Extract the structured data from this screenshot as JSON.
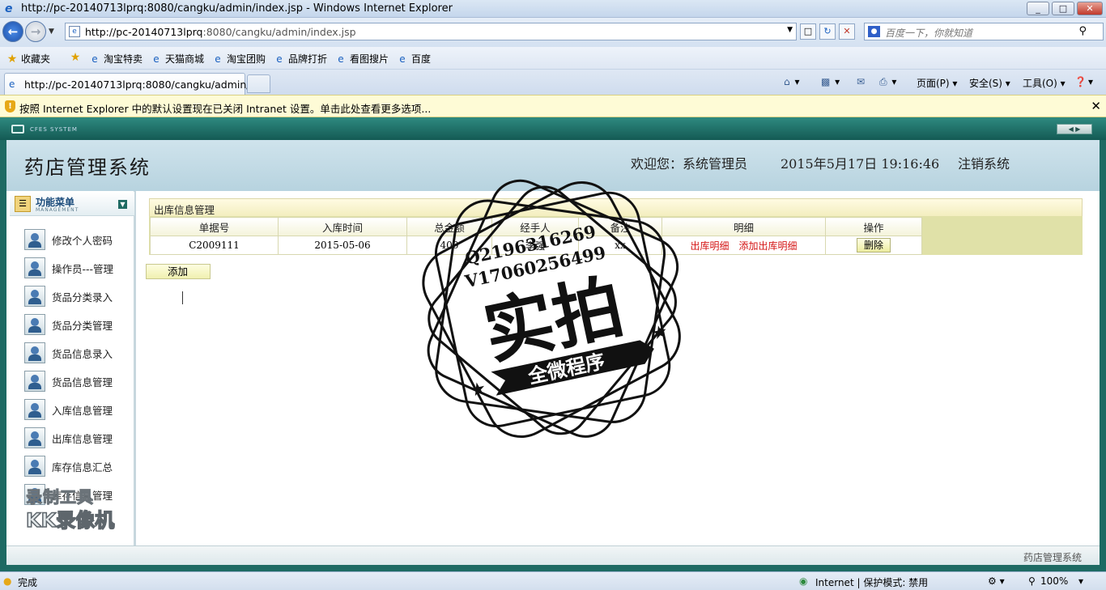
{
  "window": {
    "title": "http://pc-20140713lprq:8080/cangku/admin/index.jsp - Windows Internet Explorer",
    "controls": [
      "_",
      "□",
      "✕"
    ]
  },
  "addressbar": {
    "url_prefix": "http://pc-20140713lprq",
    "url_rest": ":8080/cangku/admin/index.jsp",
    "search_placeholder": "百度一下，你就知道"
  },
  "favorites": {
    "label": "收藏夹",
    "items": [
      "淘宝特卖",
      "天猫商城",
      "淘宝团购",
      "品牌打折",
      "看图搜片",
      "百度"
    ]
  },
  "tabs": {
    "active_title": "http://pc-20140713lprq:8080/cangku/admin/..."
  },
  "commandbar": {
    "page": "页面(P)",
    "safety": "安全(S)",
    "tools": "工具(O)"
  },
  "infobar": {
    "message": "按照 Internet Explorer 中的默认设置现在已关闭 Intranet 设置。单击此处查看更多选项..."
  },
  "app": {
    "system_tag": "CFES SYSTEM",
    "title": "药店管理系统",
    "welcome": "欢迎您：系统管理员",
    "datetime": "2015年5月17日  19:16:46",
    "logout": "注销系统",
    "footer": "药店管理系统"
  },
  "sidebar": {
    "header": "功能菜单",
    "header_sub": "MANAGEMENT",
    "items": [
      {
        "label": "修改个人密码"
      },
      {
        "label": "操作员---管理"
      },
      {
        "label": "货品分类录入"
      },
      {
        "label": "货品分类管理"
      },
      {
        "label": "货品信息录入"
      },
      {
        "label": "货品信息管理"
      },
      {
        "label": "入库信息管理"
      },
      {
        "label": "出库信息管理"
      },
      {
        "label": "库存信息汇总"
      },
      {
        "label": "库存信息管理"
      }
    ]
  },
  "panel": {
    "title": "出库信息管理",
    "columns": [
      "单据号",
      "入库时间",
      "总金额",
      "经手人",
      "备注",
      "明细",
      "操作"
    ],
    "rows": [
      {
        "id": "C2009111",
        "time": "2015-05-06",
        "amount": "400",
        "handler": "李强",
        "remark": "xx",
        "detail_link": "出库明细",
        "add_detail_link": "添加出库明细",
        "delete": "删除"
      }
    ],
    "add_button": "添加"
  },
  "statusbar": {
    "status": "完成",
    "zone": "Internet | 保护模式: 禁用",
    "zoom": "100%"
  },
  "overlays": {
    "stamp_line1": "Q2196316269",
    "stamp_line2": "V17060256499",
    "stamp_main": "实拍",
    "stamp_ribbon": "全微程序",
    "recorder_line1": "录制工具",
    "recorder_line2": "KK录像机"
  }
}
